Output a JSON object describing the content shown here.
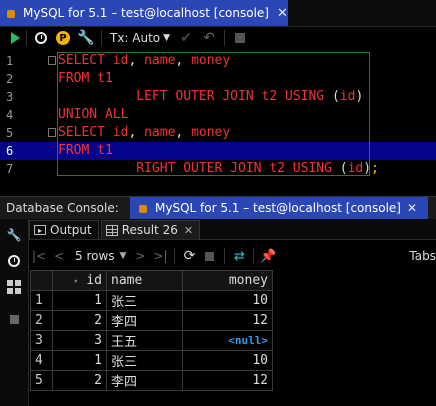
{
  "editor_tab": {
    "title": "MySQL for 5.1 – test@localhost [console]",
    "close": "✕"
  },
  "toolbar": {
    "tx_mode": "Tx: Auto"
  },
  "editor": {
    "current_line": 6,
    "lines": [
      {
        "num": "1",
        "parts": [
          [
            "SELECT ",
            "kw"
          ],
          [
            "id",
            "id"
          ],
          [
            ", ",
            "p"
          ],
          [
            "name",
            "id"
          ],
          [
            ", ",
            "p"
          ],
          [
            "money",
            "id"
          ]
        ]
      },
      {
        "num": "2",
        "parts": [
          [
            "FROM ",
            "kw"
          ],
          [
            "t1",
            "id"
          ]
        ]
      },
      {
        "num": "3",
        "parts": [
          [
            "          LEFT OUTER JOIN ",
            "kw"
          ],
          [
            "t2",
            "id"
          ],
          [
            " USING ",
            "kw"
          ],
          [
            "(",
            "p"
          ],
          [
            "id",
            "id"
          ],
          [
            ")",
            "p"
          ]
        ]
      },
      {
        "num": "4",
        "parts": [
          [
            "UNION ALL",
            "kw"
          ]
        ]
      },
      {
        "num": "5",
        "parts": [
          [
            "SELECT ",
            "kw"
          ],
          [
            "id",
            "id"
          ],
          [
            ", ",
            "p"
          ],
          [
            "name",
            "id"
          ],
          [
            ", ",
            "p"
          ],
          [
            "money",
            "id"
          ]
        ]
      },
      {
        "num": "6",
        "parts": [
          [
            "FROM ",
            "kw"
          ],
          [
            "t1",
            "id"
          ]
        ]
      },
      {
        "num": "7",
        "parts": [
          [
            "          RIGHT OUTER JOIN ",
            "kw"
          ],
          [
            "t2",
            "id"
          ],
          [
            " USING ",
            "kw"
          ],
          [
            "(",
            "p"
          ],
          [
            "id",
            "id"
          ],
          [
            ")",
            "p"
          ],
          [
            ";",
            "y"
          ]
        ]
      }
    ]
  },
  "console_bar": {
    "label": "Database Console:",
    "tab_title": "MySQL for 5.1 – test@localhost [console]",
    "close": "✕"
  },
  "result_tabs": [
    {
      "label": "Output",
      "active": false
    },
    {
      "label": "Result 26",
      "active": true,
      "close": "✕"
    }
  ],
  "result_toolbar": {
    "rows_label": "5 rows",
    "tabs_label": "Tabs"
  },
  "grid": {
    "columns": [
      "id",
      "name",
      "money"
    ],
    "rows": [
      {
        "rn": "1",
        "id": "1",
        "name": "张三",
        "money": "10"
      },
      {
        "rn": "2",
        "id": "2",
        "name": "李四",
        "money": "12"
      },
      {
        "rn": "3",
        "id": "3",
        "name": "王五",
        "money": "<null>"
      },
      {
        "rn": "4",
        "id": "1",
        "name": "张三",
        "money": "10"
      },
      {
        "rn": "5",
        "id": "2",
        "name": "李四",
        "money": "12"
      }
    ]
  },
  "colors": {
    "tab_active": "#2b47b5",
    "keyword": "#ee3333",
    "current_line": "#05058b",
    "null_value": "#2c9cf0",
    "run_button": "#22c15a"
  }
}
